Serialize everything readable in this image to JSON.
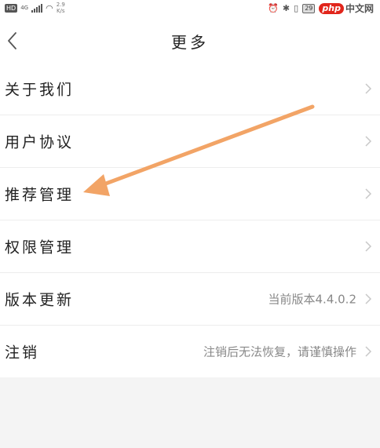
{
  "status_bar": {
    "hd": "HD",
    "network": "4G",
    "speed_top": "2.9",
    "speed_bottom": "K/s",
    "battery": "29",
    "watermark_php": "php",
    "watermark_cn": "中文网"
  },
  "header": {
    "title": "更多"
  },
  "settings": {
    "items": [
      {
        "label": "关于我们",
        "value": ""
      },
      {
        "label": "用户协议",
        "value": ""
      },
      {
        "label": "推荐管理",
        "value": ""
      },
      {
        "label": "权限管理",
        "value": ""
      },
      {
        "label": "版本更新",
        "value": "当前版本4.4.0.2"
      },
      {
        "label": "注销",
        "value": "注销后无法恢复，请谨慎操作"
      }
    ]
  },
  "annotation": {
    "color": "#f0a060",
    "points_to": "推荐管理"
  }
}
